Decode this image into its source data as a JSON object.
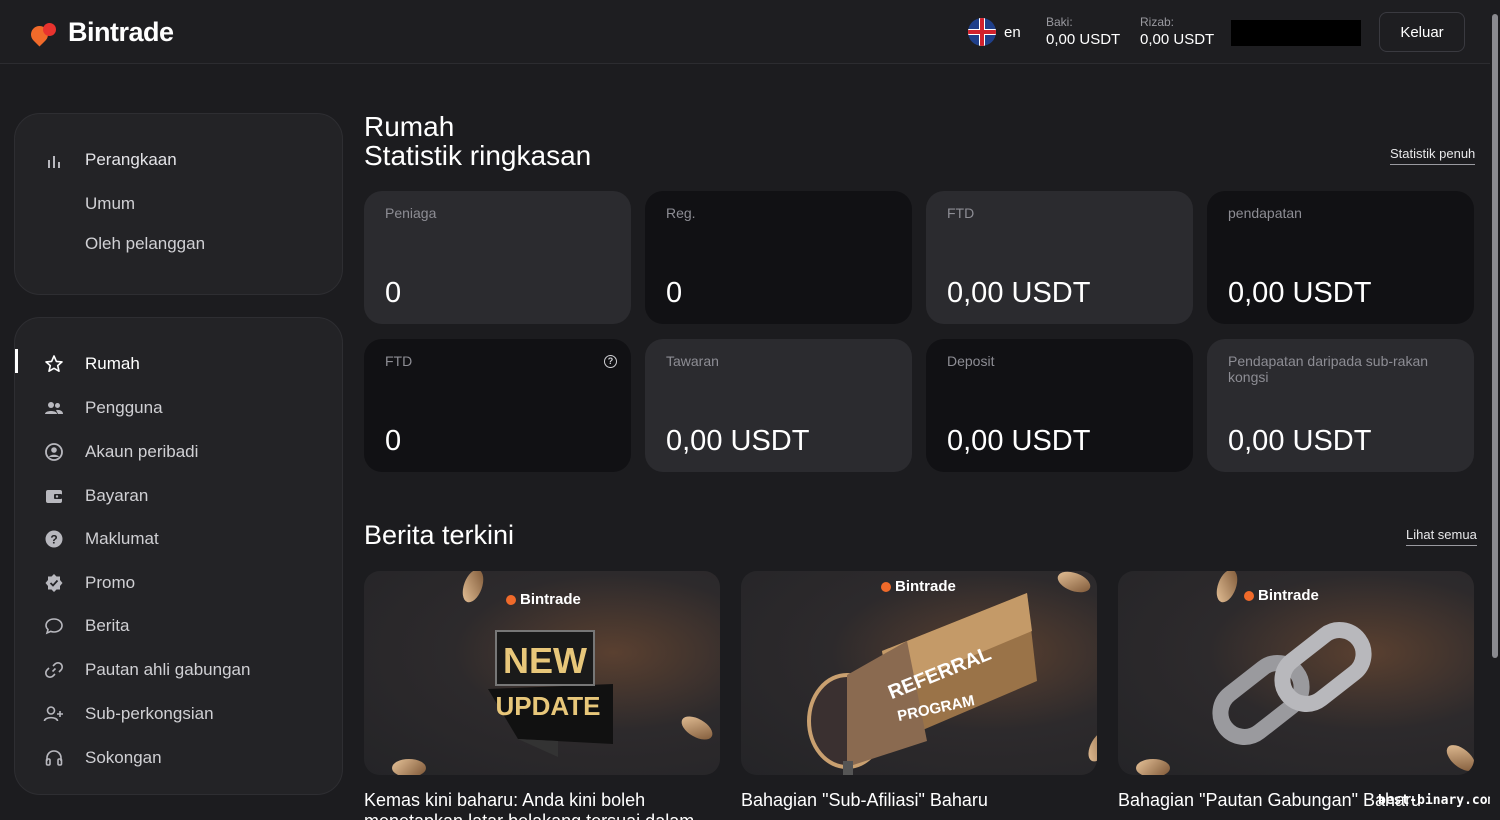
{
  "header": {
    "brand": "Bintrade",
    "language": "en",
    "balance_label": "Baki:",
    "balance_value": "0,00 USDT",
    "withdraw_label": "Rizab:",
    "withdraw_value": "0,00 USDT",
    "logout_label": "Keluar"
  },
  "sidebar": {
    "settings": {
      "title": "Perangkaan",
      "items": [
        "Umum",
        "Oleh pelanggan"
      ]
    },
    "nav": [
      {
        "label": "Rumah",
        "icon": "star-icon"
      },
      {
        "label": "Pengguna",
        "icon": "users-icon"
      },
      {
        "label": "Akaun peribadi",
        "icon": "user-circle-icon"
      },
      {
        "label": "Bayaran",
        "icon": "wallet-icon"
      },
      {
        "label": "Maklumat",
        "icon": "help-circle-icon"
      },
      {
        "label": "Promo",
        "icon": "badge-check-icon"
      },
      {
        "label": "Berita",
        "icon": "chat-bubble-icon"
      },
      {
        "label": "Pautan ahli gabungan",
        "icon": "link-icon"
      },
      {
        "label": "Sub-perkongsian",
        "icon": "user-plus-icon"
      },
      {
        "label": "Sokongan",
        "icon": "headphones-icon"
      }
    ]
  },
  "main": {
    "title": "Rumah",
    "subtitle": "Statistik ringkasan",
    "full_stats_link": "Statistik penuh",
    "cards": [
      {
        "label": "Peniaga",
        "value": "0"
      },
      {
        "label": "Reg.",
        "value": "0"
      },
      {
        "label": "FTD",
        "value": "0,00 USDT"
      },
      {
        "label": "pendapatan",
        "value": "0,00 USDT"
      },
      {
        "label": "FTD",
        "value": "0"
      },
      {
        "label": "Tawaran",
        "value": "0,00 USDT"
      },
      {
        "label": "Deposit",
        "value": "0,00 USDT"
      },
      {
        "label": "Pendapatan daripada sub-rakan kongsi",
        "value": "0,00 USDT"
      }
    ],
    "news_title": "Berita terkini",
    "see_all_link": "Lihat semua",
    "news": [
      {
        "brand": "Bintrade",
        "art_top": "NEW",
        "art_bottom": "UPDATE",
        "caption": "Kemas kini baharu: Anda kini boleh",
        "caption2": "menetapkan latar belakang tersuai dalam"
      },
      {
        "brand": "Bintrade",
        "art_top": "REFERRAL",
        "art_bottom": "PROGRAM",
        "caption": "Bahagian \"Sub-Afiliasi\" Baharu"
      },
      {
        "brand": "Bintrade",
        "caption": "Bahagian \"Pautan Gabungan\" Baharu"
      }
    ],
    "watermark": "best-binary.com"
  }
}
